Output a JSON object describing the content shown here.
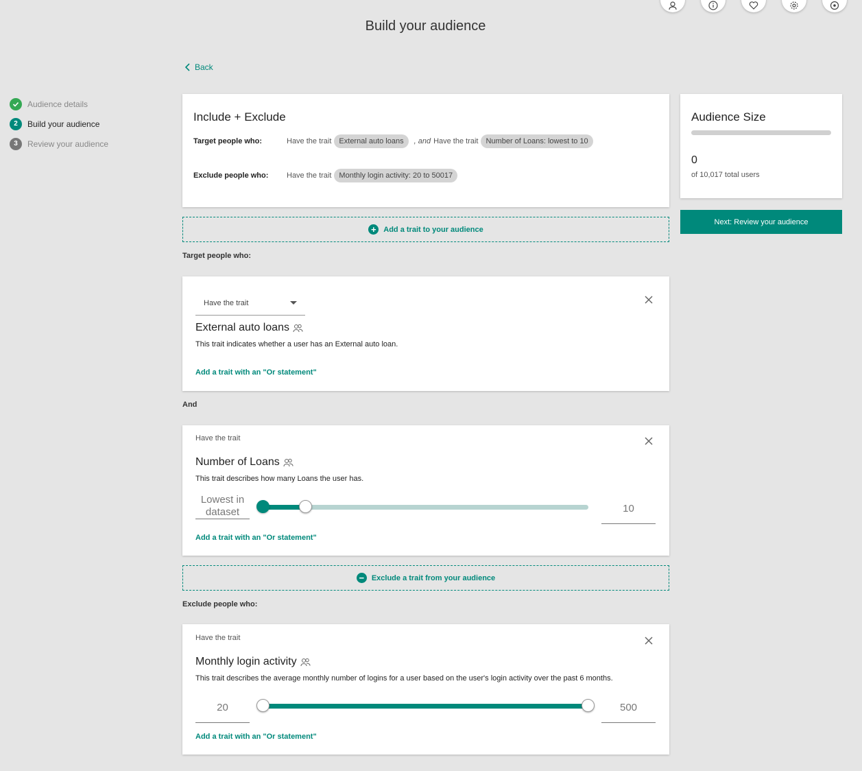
{
  "header": {
    "title": "Build your audience",
    "icons": [
      "user-icon",
      "info-icon",
      "heart-icon",
      "settings-icon",
      "location-icon"
    ]
  },
  "back_label": "Back",
  "steps": [
    {
      "num": "✓",
      "label": "Audience details",
      "state": "done"
    },
    {
      "num": "2",
      "label": "Build your audience",
      "state": "active"
    },
    {
      "num": "3",
      "label": "Review your audience",
      "state": "pending"
    }
  ],
  "summary": {
    "title": "Include + Exclude",
    "target_label": "Target people who:",
    "exclude_label": "Exclude people who:",
    "have_trait": "Have the trait",
    "and_text": ", and",
    "target_chips": [
      "External auto loans",
      "Number of Loans: lowest to 10"
    ],
    "exclude_chips": [
      "Monthly login activity: 20 to 50017"
    ]
  },
  "audience_size": {
    "title": "Audience Size",
    "count": "0",
    "total_text": "of 10,017 total users",
    "fill_fraction": 0
  },
  "next_button": "Next: Review your audience",
  "add_trait_button": "Add a trait to your audience",
  "exclude_trait_button": "Exclude a trait from your audience",
  "target_section_label": "Target people who:",
  "and_label": "And",
  "exclude_section_label": "Exclude people who:",
  "traits": [
    {
      "condition": "Have the trait",
      "name": "External auto loans",
      "description": "This trait indicates whether a user has an External auto loan.",
      "or_link": "Add a trait with an \"Or statement\""
    },
    {
      "condition": "Have the trait",
      "name": "Number of Loans",
      "description": "This trait describes how many Loans the user has.",
      "min_label": "Lowest in dataset",
      "max_value": "10",
      "or_link": "Add a trait with an \"Or statement\""
    },
    {
      "condition": "Have the trait",
      "name": "Monthly login activity",
      "description": "This trait describes the average monthly number of logins for a user based on the user's login activity over the past 6 months.",
      "min_value": "20",
      "max_value": "500",
      "or_link": "Add a trait with an \"Or statement\""
    }
  ],
  "colors": {
    "accent": "#00897b",
    "done": "#34a853"
  }
}
